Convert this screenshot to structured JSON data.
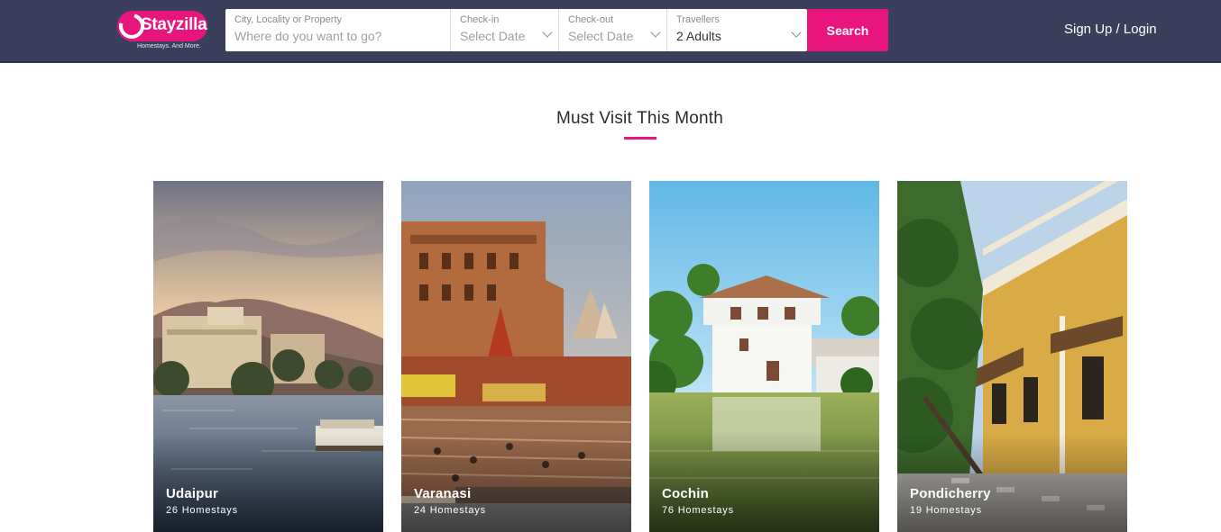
{
  "header": {
    "logo_text": "Stayzilla",
    "logo_tagline": "Homestays. And More.",
    "search": {
      "city_label": "City, Locality or Property",
      "city_placeholder": "Where do you want to go?",
      "checkin_label": "Check-in",
      "checkin_value": "Select Date",
      "checkout_label": "Check-out",
      "checkout_value": "Select Date",
      "travellers_label": "Travellers",
      "travellers_value": "2 Adults",
      "button_label": "Search"
    },
    "auth_label": "Sign Up / Login"
  },
  "section": {
    "title": "Must Visit This Month"
  },
  "destinations": [
    {
      "name": "Udaipur",
      "count": "26 Homestays"
    },
    {
      "name": "Varanasi",
      "count": "24 Homestays"
    },
    {
      "name": "Cochin",
      "count": "76 Homestays"
    },
    {
      "name": "Pondicherry",
      "count": "19 Homestays"
    }
  ],
  "colors": {
    "header_bg": "#3b3f5c",
    "accent": "#e8157d"
  }
}
